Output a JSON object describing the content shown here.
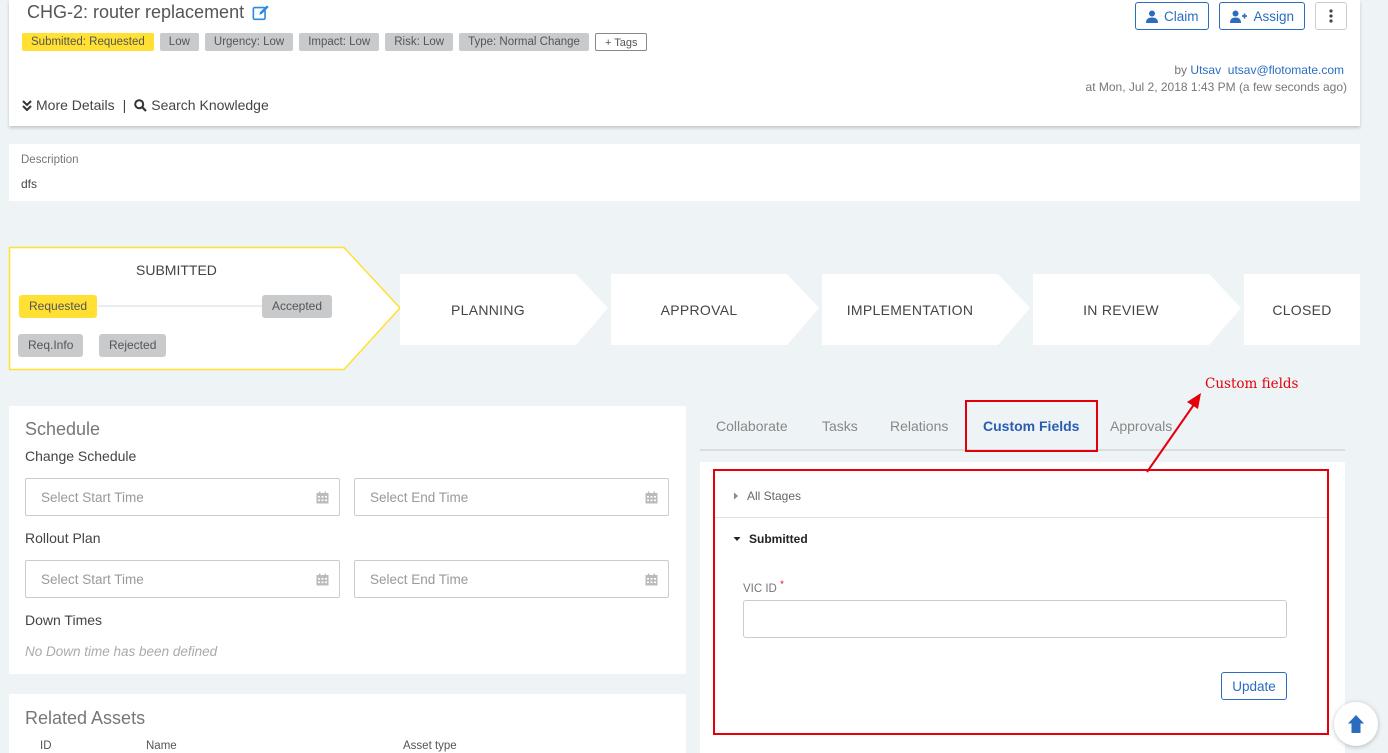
{
  "header": {
    "title": "CHG-2: router replacement",
    "tags": [
      "Submitted: Requested",
      "Low",
      "Urgency: Low",
      "Impact: Low",
      "Risk: Low",
      "Type: Normal Change"
    ],
    "add_tags_label": "+ Tags",
    "claim_label": "Claim",
    "assign_label": "Assign",
    "by_prefix": "by",
    "by_user": "Utsav",
    "by_email": "utsav@flotomate.com",
    "at_line": "at Mon, Jul 2, 2018 1:43 PM (a few seconds ago)",
    "more_details_label": "More Details",
    "separator": "|",
    "search_knowledge_label": "Search Knowledge"
  },
  "description": {
    "label": "Description",
    "value": "dfs"
  },
  "stages": {
    "current": "SUBMITTED",
    "current_substages": {
      "requested": "Requested",
      "accepted": "Accepted",
      "req_info": "Req.Info",
      "rejected": "Rejected"
    },
    "next": [
      "PLANNING",
      "APPROVAL",
      "IMPLEMENTATION",
      "IN REVIEW",
      "CLOSED"
    ]
  },
  "schedule": {
    "title": "Schedule",
    "change_schedule_label": "Change Schedule",
    "rollout_plan_label": "Rollout Plan",
    "down_times_label": "Down Times",
    "start_placeholder": "Select Start Time",
    "end_placeholder": "Select End Time",
    "no_down_time": "No Down time has been defined"
  },
  "related_assets": {
    "title": "Related Assets",
    "columns": [
      "ID",
      "Name",
      "Asset type"
    ]
  },
  "tabs": [
    "Collaborate",
    "Tasks",
    "Relations",
    "Custom Fields",
    "Approvals"
  ],
  "active_tab": "Custom Fields",
  "custom_fields": {
    "all_stages_label": "All Stages",
    "submitted_label": "Submitted",
    "vic_id_label": "VIC ID",
    "required_mark": "*",
    "update_label": "Update"
  },
  "annotation": {
    "label": "Custom fields",
    "color": "#e3000b"
  },
  "colors": {
    "accent": "#2a6dbf",
    "highlight_yellow": "#ffe033",
    "chip_gray": "#c8cacc"
  }
}
